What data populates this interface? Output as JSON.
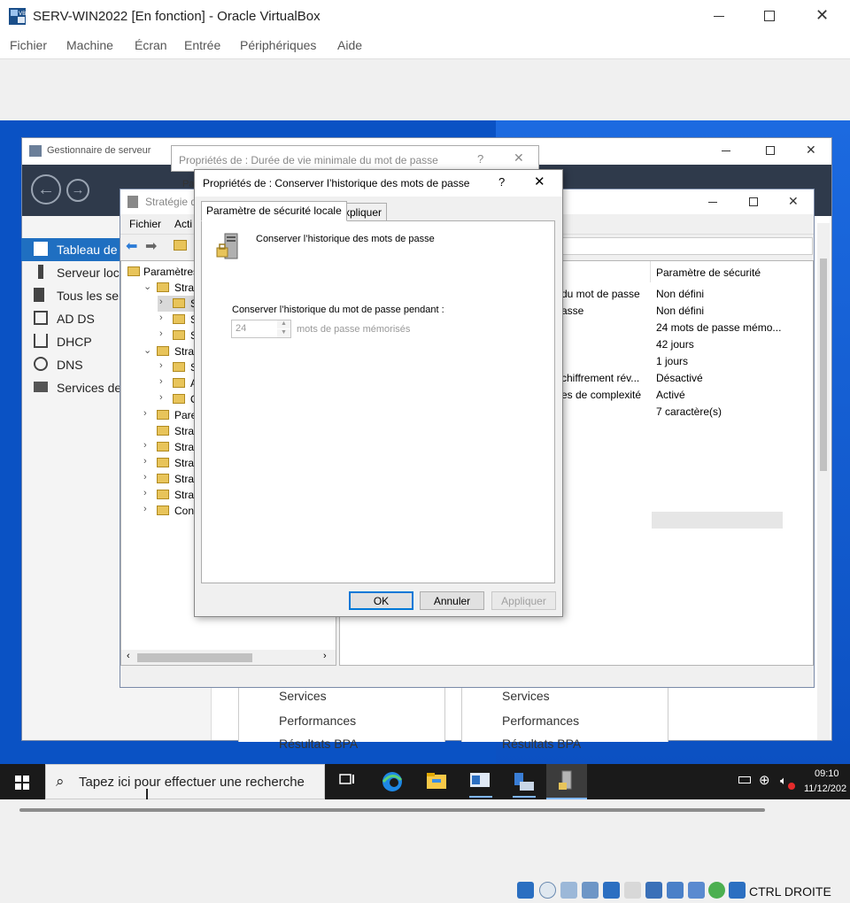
{
  "host_window": {
    "title": "SERV-WIN2022 [En fonction] - Oracle VirtualBox",
    "menu": [
      "Fichier",
      "Machine",
      "Écran",
      "Entrée",
      "Périphériques",
      "Aide"
    ]
  },
  "server_manager": {
    "title": "Gestionnaire de serveur",
    "nav": [
      {
        "label": "Tableau de",
        "icon": "dashboard-icon",
        "active": true
      },
      {
        "label": "Serveur loca",
        "icon": "server-icon",
        "active": false
      },
      {
        "label": "Tous les serv",
        "icon": "servers-icon",
        "active": false
      },
      {
        "label": "AD DS",
        "icon": "ad-ds-icon",
        "active": false
      },
      {
        "label": "DHCP",
        "icon": "dhcp-icon",
        "active": false
      },
      {
        "label": "DNS",
        "icon": "dns-icon",
        "active": false
      },
      {
        "label": "Services de",
        "icon": "file-services-icon",
        "active": false
      }
    ],
    "tiles": [
      {
        "services": "Services",
        "performance": "Performances",
        "bpa": "Résultats BPA"
      },
      {
        "services": "Services",
        "performance": "Performances",
        "bpa": "Résultats BPA"
      }
    ]
  },
  "gpo_editor": {
    "title": "Stratégie d",
    "menu": [
      "Fichier",
      "Acti"
    ],
    "tree": [
      {
        "label": "Paramètres",
        "indent": 0,
        "chevron": ""
      },
      {
        "label": "Stratég",
        "indent": 1,
        "chevron": "v"
      },
      {
        "label": "Stra",
        "indent": 2,
        "chevron": ">"
      },
      {
        "label": "Stra",
        "indent": 2,
        "chevron": ">"
      },
      {
        "label": "Stra",
        "indent": 2,
        "chevron": ">"
      },
      {
        "label": "Stratég",
        "indent": 1,
        "chevron": "v"
      },
      {
        "label": "Stra",
        "indent": 2,
        "chevron": ">"
      },
      {
        "label": "Attri",
        "indent": 2,
        "chevron": ">"
      },
      {
        "label": "Opt",
        "indent": 2,
        "chevron": ">"
      },
      {
        "label": "Pare-fe",
        "indent": 1,
        "chevron": ">"
      },
      {
        "label": "Stratég",
        "indent": 1,
        "chevron": ""
      },
      {
        "label": "Stratég",
        "indent": 1,
        "chevron": ">"
      },
      {
        "label": "Stratég",
        "indent": 1,
        "chevron": ">"
      },
      {
        "label": "Stratég",
        "indent": 1,
        "chevron": ">"
      },
      {
        "label": "Stratég",
        "indent": 1,
        "chevron": ">"
      },
      {
        "label": "Configu",
        "indent": 1,
        "chevron": ">"
      }
    ],
    "list_header": "Paramètre de sécurité",
    "list_rows": [
      {
        "policy": "du mot de passe",
        "value": "Non défini"
      },
      {
        "policy": "asse",
        "value": "Non défini"
      },
      {
        "policy": "",
        "value": "24 mots de passe mémo..."
      },
      {
        "policy": "",
        "value": "42 jours"
      },
      {
        "policy": "",
        "value": "1 jours"
      },
      {
        "policy": "chiffrement rév...",
        "value": "Désactivé"
      },
      {
        "policy": "es de complexité",
        "value": "Activé"
      },
      {
        "policy": "",
        "value": "7 caractère(s)"
      }
    ]
  },
  "back_dialog": {
    "title": "Propriétés de : Durée de vie minimale du mot de passe",
    "help": "?",
    "field_fragment": "Pa"
  },
  "dialog": {
    "title": "Propriétés de : Conserver l’historique des mots de passe",
    "help": "?",
    "tabs": [
      "Paramètre de sécurité locale",
      "Expliquer"
    ],
    "policy_name": "Conserver l’historique des mots de passe",
    "field_label": "Conserver l’historique du mot de passe pendant :",
    "value": "24",
    "unit": "mots de passe mémorisés",
    "buttons": {
      "ok": "OK",
      "cancel": "Annuler",
      "apply": "Appliquer"
    }
  },
  "taskbar": {
    "search_placeholder": "Tapez ici pour effectuer une recherche",
    "time": "09:10",
    "date": "11/12/202"
  },
  "status_bar": {
    "host_key": "CTRL DROITE"
  }
}
